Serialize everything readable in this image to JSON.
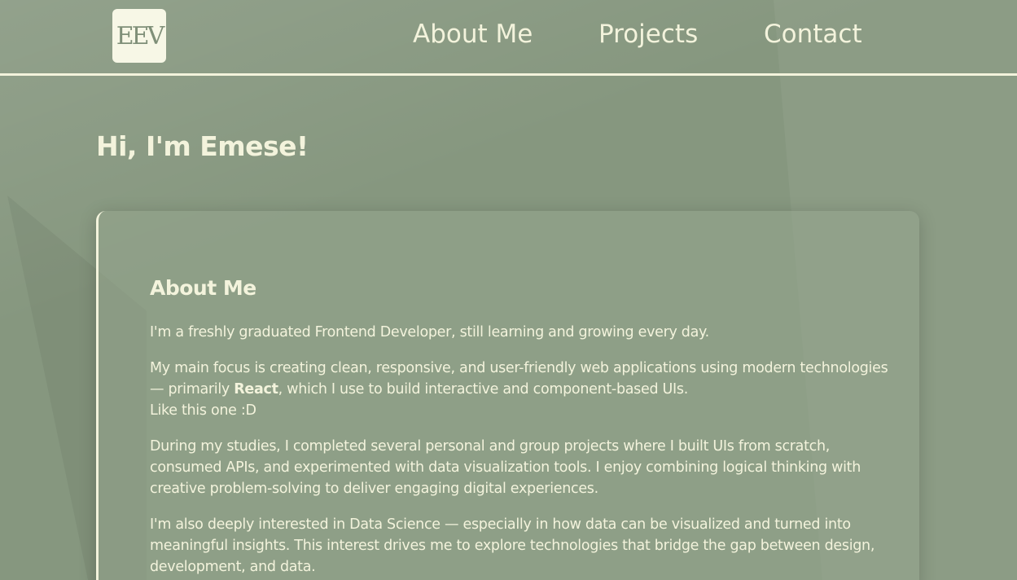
{
  "logo": {
    "text": "EEV"
  },
  "nav": {
    "about": "About Me",
    "projects": "Projects",
    "contact": "Contact"
  },
  "hero": {
    "greeting": "Hi, I'm Emese!"
  },
  "about": {
    "title": "About Me",
    "p1": "I'm a freshly graduated Frontend Developer, still learning and growing every day.",
    "p2_before": "My main focus is creating clean, responsive, and user-friendly web applications using modern technologies — primarily ",
    "p2_bold": "React",
    "p2_after": ", which I use to build interactive and component-based UIs.",
    "p2_line3": "Like this one :D",
    "p3": "During my studies, I completed several personal and group projects where I built UIs from scratch, consumed APIs, and experimented with data visualization tools. I enjoy combining logical thinking with creative problem-solving to deliver engaging digital experiences.",
    "p4": "I'm also deeply interested in Data Science — especially in how data can be visualized and turned into meaningful insights. This interest drives me to explore technologies that bridge the gap between design, development, and data."
  },
  "colors": {
    "background": "#86977f",
    "text": "#f3f3dc",
    "logo_bg": "#f7f7e6"
  }
}
